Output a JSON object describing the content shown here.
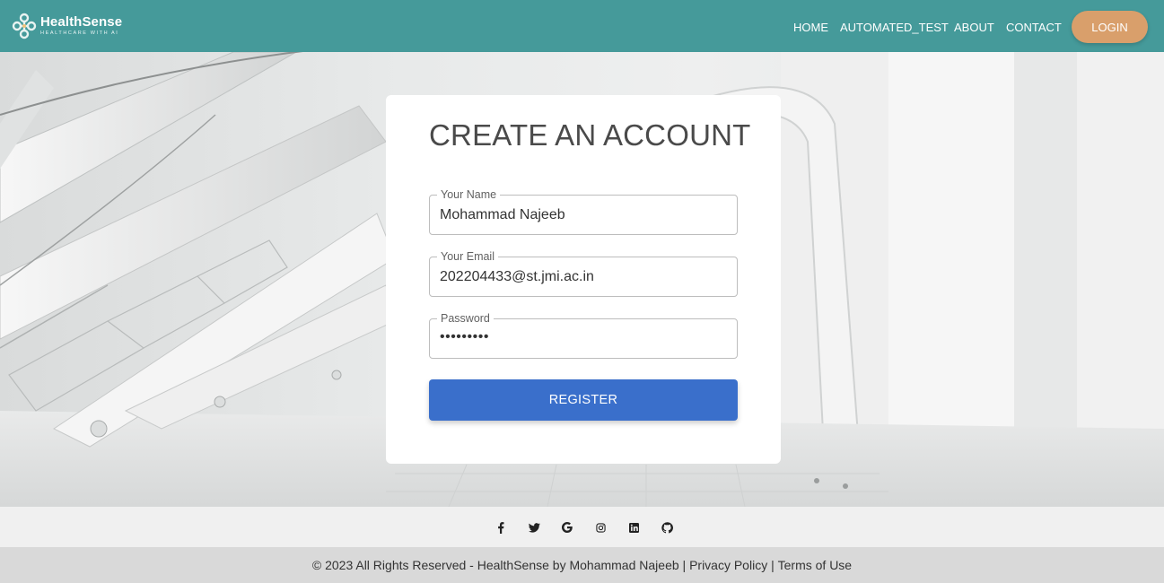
{
  "brand": {
    "name": "HealthSense",
    "tagline": "HEALTHCARE WITH AI"
  },
  "nav": {
    "links": [
      "HOME",
      "AUTOMATED_TEST",
      "ABOUT",
      "CONTACT"
    ],
    "login_label": "LOGIN"
  },
  "form": {
    "title": "CREATE AN ACCOUNT",
    "name_label": "Your Name",
    "name_value": "Mohammad Najeeb",
    "email_label": "Your Email",
    "email_value": "202204433@st.jmi.ac.in",
    "password_label": "Password",
    "password_value": "•••••••••",
    "register_label": "REGISTER"
  },
  "social": {
    "icons": [
      "facebook-icon",
      "twitter-icon",
      "google-icon",
      "instagram-icon",
      "linkedin-icon",
      "github-icon"
    ]
  },
  "footer": {
    "copyright": "© 2023 All Rights Reserved - HealthSense by Mohammad Najeeb | ",
    "privacy": "Privacy Policy",
    "separator": " | ",
    "terms": "Terms of Use"
  },
  "colors": {
    "navbar": "#459a9a",
    "login_button": "#d99f6b",
    "register_button": "#3a6fcb"
  }
}
